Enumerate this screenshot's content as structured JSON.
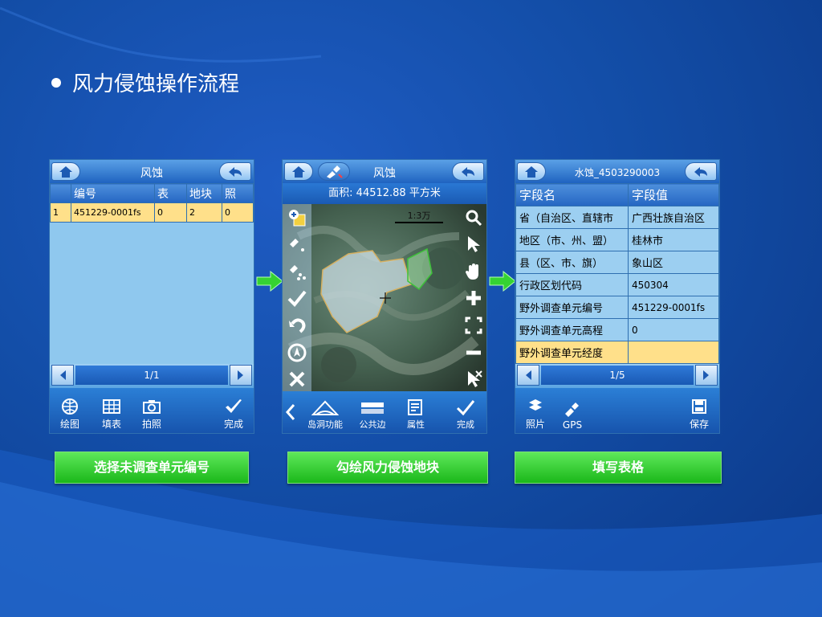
{
  "page": {
    "title": "风力侵蚀操作流程"
  },
  "screen1": {
    "title": "风蚀",
    "columns": [
      "编号",
      "表",
      "地块",
      "照"
    ],
    "rows": [
      {
        "idx": "1",
        "code": "451229-0001fs",
        "table": "0",
        "plots": "2",
        "photos": "0"
      }
    ],
    "pager": "1/1",
    "bottom": [
      "绘图",
      "填表",
      "拍照",
      "完成"
    ]
  },
  "screen2": {
    "title": "风蚀",
    "area": "面积: 44512.88 平方米",
    "scale": "1:3万",
    "bottom": [
      "岛洞功能",
      "公共边",
      "属性",
      "完成"
    ]
  },
  "screen3": {
    "title": "水蚀_4503290003",
    "header": [
      "字段名",
      "字段值"
    ],
    "rows": [
      {
        "name": "省（自治区、直辖市",
        "value": "广西壮族自治区"
      },
      {
        "name": "地区（市、州、盟）",
        "value": "桂林市"
      },
      {
        "name": "县（区、市、旗）",
        "value": "象山区"
      },
      {
        "name": "行政区划代码",
        "value": "450304"
      },
      {
        "name": "野外调查单元编号",
        "value": "451229-0001fs"
      },
      {
        "name": "野外调查单元高程",
        "value": "0"
      },
      {
        "name": "野外调查单元经度",
        "value": ""
      }
    ],
    "pager": "1/5",
    "bottom": [
      "照片",
      "GPS",
      "保存"
    ]
  },
  "steps": [
    "选择未调查单元编号",
    "勾绘风力侵蚀地块",
    "填写表格"
  ],
  "colors": {
    "step_button": "#2ec42c",
    "selected_row": "#ffe08a",
    "panel": "#8fc8ee",
    "background": "#134ea8"
  }
}
